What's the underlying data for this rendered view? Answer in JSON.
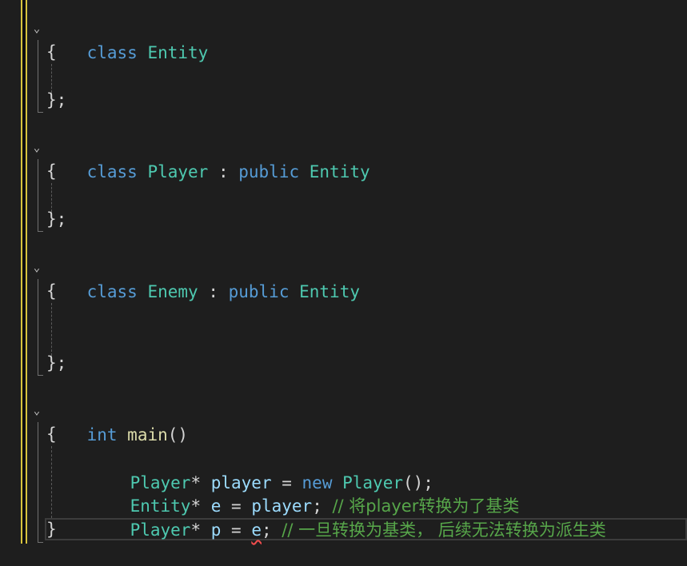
{
  "editor": {
    "lines": {
      "l1": {
        "kw": "class",
        "name": "Entity"
      },
      "l2": {
        "text": "{"
      },
      "l4": {
        "text": "};"
      },
      "l6": {
        "kw": "class",
        "name": "Player",
        "colon": " : ",
        "access": "public",
        "base": "Entity"
      },
      "l7": {
        "text": "{"
      },
      "l9": {
        "text": "};"
      },
      "l11": {
        "kw": "class",
        "name": "Enemy",
        "colon": " : ",
        "access": "public",
        "base": "Entity"
      },
      "l12": {
        "text": "{"
      },
      "l15": {
        "text": "};"
      },
      "l17": {
        "kw": "int",
        "fn": "main",
        "parens": "()"
      },
      "l18": {
        "text": "{"
      },
      "l19": {
        "type": "Player",
        "star": "* ",
        "var": "player",
        "eq": " = ",
        "new": "new",
        "ctor": "Player",
        "rest": "();"
      },
      "l20": {
        "type": "Entity",
        "star": "* ",
        "var": "e",
        "eq": " = ",
        "rhs": "player",
        "semi": "; ",
        "comment": "// 将player转换为了基类"
      },
      "l21": {
        "type": "Player",
        "star": "* ",
        "var": "p",
        "eq": " = ",
        "rhs": "e",
        "semi": "; ",
        "comment": "// 一旦转换为基类， 后续无法转换为派生类"
      },
      "l22": {
        "text": "}"
      }
    },
    "fold_glyph": "⌄"
  },
  "colors": {
    "background": "#1e1e1e",
    "keyword": "#569cd6",
    "type": "#4ec9b0",
    "variable": "#9cdcfe",
    "function": "#dcdcaa",
    "comment": "#57a64a",
    "error_squiggle": "#f14c4c",
    "change_bar": "#d9c53f"
  }
}
